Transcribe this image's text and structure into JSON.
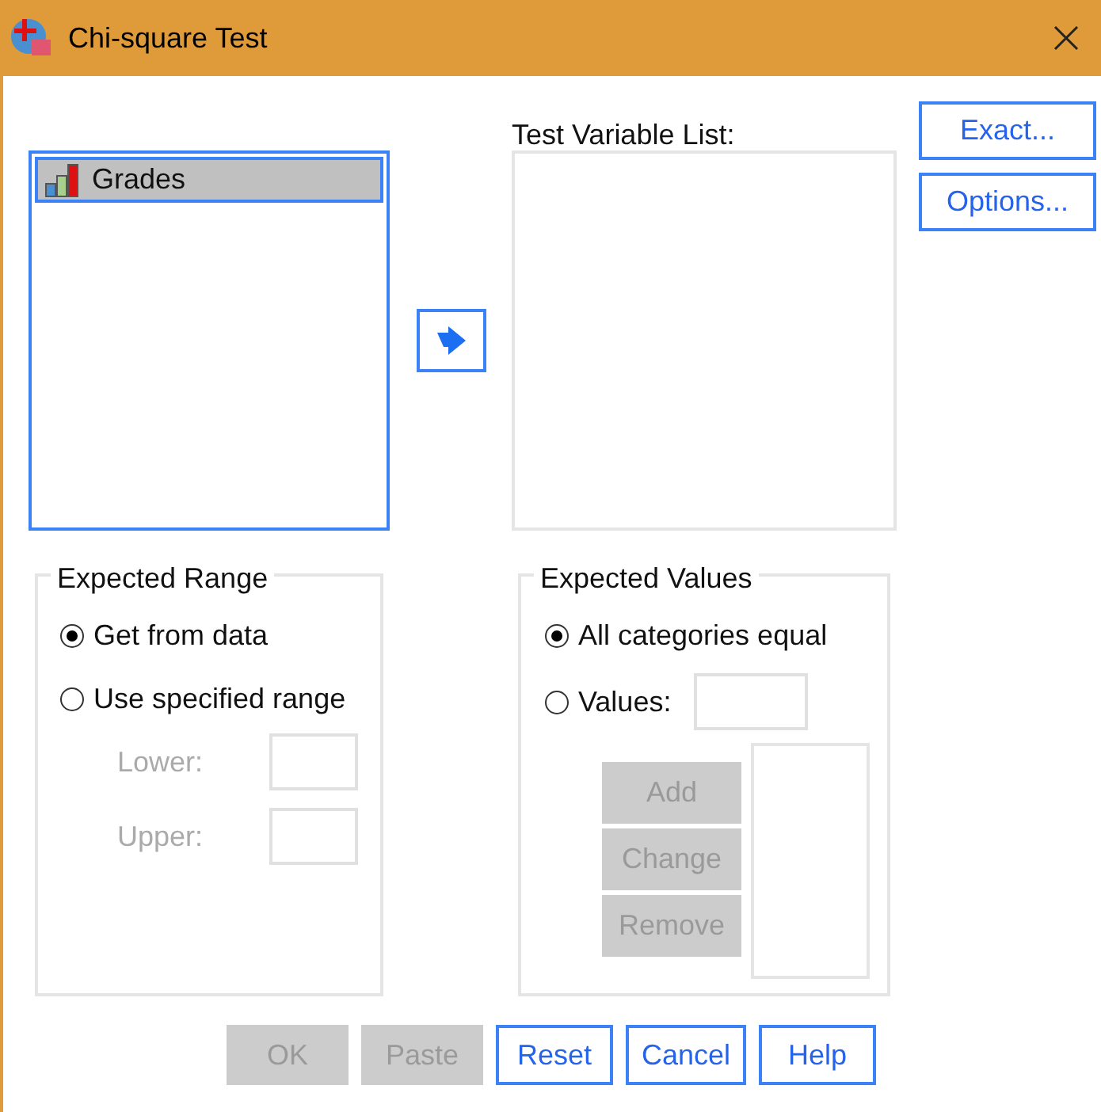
{
  "window": {
    "title": "Chi-square Test"
  },
  "source_list": {
    "items": [
      {
        "label": "Grades",
        "selected": true
      }
    ]
  },
  "test_variable_list": {
    "label": "Test Variable List:"
  },
  "side_buttons": [
    {
      "label": "Exact..."
    },
    {
      "label": "Options..."
    }
  ],
  "expected_range": {
    "title": "Expected Range",
    "options": [
      {
        "label": "Get from data",
        "selected": true
      },
      {
        "label": "Use specified range",
        "selected": false
      }
    ],
    "fields": [
      {
        "label": "Lower:",
        "disabled": true
      },
      {
        "label": "Upper:",
        "disabled": true
      }
    ]
  },
  "expected_values": {
    "title": "Expected Values",
    "options": [
      {
        "label": "All categories equal",
        "selected": true
      },
      {
        "label": "Values:",
        "selected": false
      }
    ],
    "buttons": [
      {
        "label": "Add",
        "disabled": true
      },
      {
        "label": "Change",
        "disabled": true
      },
      {
        "label": "Remove",
        "disabled": true
      }
    ]
  },
  "footer_buttons": [
    {
      "label": "OK",
      "disabled": true
    },
    {
      "label": "Paste",
      "disabled": true
    },
    {
      "label": "Reset",
      "disabled": false
    },
    {
      "label": "Cancel",
      "disabled": false
    },
    {
      "label": "Help",
      "disabled": false
    }
  ]
}
